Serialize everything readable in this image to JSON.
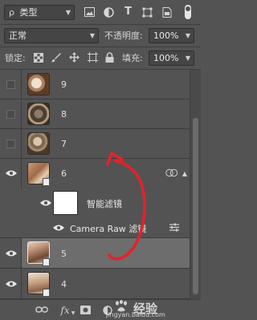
{
  "filter_bar": {
    "search_glyph": "ρ",
    "kind_label": "类型",
    "icons": [
      "image-filter-icon",
      "adjustment-filter-icon",
      "type-filter-icon",
      "shape-filter-icon",
      "smart-object-filter-icon",
      "filter-toggle-icon"
    ]
  },
  "blend_bar": {
    "blend_mode": "正常",
    "opacity_label": "不透明度:",
    "opacity_value": "100%"
  },
  "lock_bar": {
    "lock_label": "锁定:",
    "fill_label": "填充:",
    "fill_value": "100%"
  },
  "layers": [
    {
      "name": "9",
      "visible": false,
      "selected": false
    },
    {
      "name": "8",
      "visible": false,
      "selected": false
    },
    {
      "name": "7",
      "visible": false,
      "selected": false
    },
    {
      "name": "6",
      "visible": true,
      "selected": false
    },
    {
      "name": "智能滤镜",
      "visible": true,
      "selected": false
    },
    {
      "name": "Camera Raw 滤镜",
      "visible": true,
      "selected": false
    },
    {
      "name": "5",
      "visible": true,
      "selected": true
    },
    {
      "name": "4",
      "visible": true,
      "selected": false
    }
  ],
  "watermark": {
    "brand": "经验",
    "site": "jingyan.baidu.com"
  },
  "colors": {
    "panel_bg": "#535353",
    "selected_row": "#6d6d6d",
    "annotation_red": "#e8202a"
  }
}
